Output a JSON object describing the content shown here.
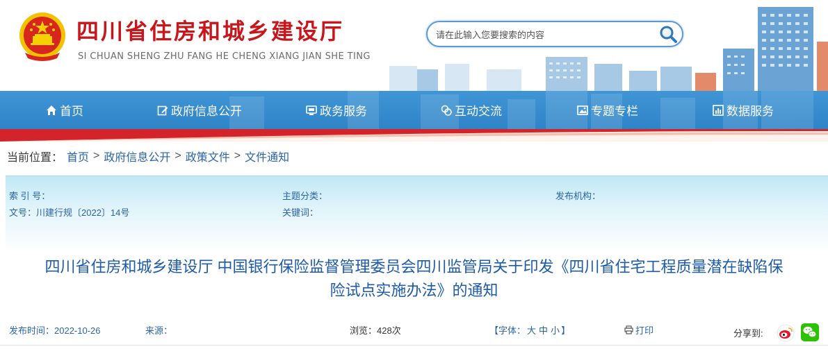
{
  "header": {
    "title": "四川省住房和城乡建设厅",
    "subtitle": "SI CHUAN SHENG ZHU FANG HE CHENG XIANG JIAN SHE TING",
    "emblem_icon": "national-emblem-icon"
  },
  "search": {
    "placeholder": "请在此输入您要搜索的内容",
    "icon": "search-icon"
  },
  "nav": {
    "items": [
      {
        "label": "首页",
        "icon": "home-icon"
      },
      {
        "label": "政府信息公开",
        "icon": "edit-icon"
      },
      {
        "label": "政务服务",
        "icon": "monitor-icon"
      },
      {
        "label": "互动交流",
        "icon": "chat-icon"
      },
      {
        "label": "专题专栏",
        "icon": "image-icon"
      },
      {
        "label": "数据服务",
        "icon": "chart-icon"
      }
    ]
  },
  "breadcrumb": {
    "prefix": "当前位置：",
    "items": [
      "首页",
      "政府信息公开",
      "政策文件",
      "文件通知"
    ],
    "separator": ">"
  },
  "meta": {
    "index_label": "索 引 号：",
    "index_value": "",
    "topic_label": "主题分类：",
    "topic_value": "",
    "publisher_label": "发布机构：",
    "publisher_value": "",
    "doc_no_label": "文号：",
    "doc_no_value": "川建行规〔2022〕14号",
    "keywords_label": "关键词：",
    "keywords_value": ""
  },
  "article": {
    "title_line1": "四川省住房和城乡建设厅 中国银行保险监督管理委员会四川监管局关于印发《四川省住宅工程质量潜在缺陷保",
    "title_line2": "险试点实施办法》的通知",
    "publish_time_label": "发布时间：",
    "publish_time": "2022-10-26",
    "source_label": "来源：",
    "source_value": "",
    "views_label": "浏览：",
    "views_value": "428次",
    "font_label": "【字体：",
    "font_large": "大",
    "font_medium": "中",
    "font_small": "小",
    "font_close": "】",
    "print_label": "打印",
    "share_label": "分享到:",
    "share_icons": [
      "weibo-icon",
      "wechat-icon"
    ]
  },
  "colors": {
    "nav_blue": "#3f95d5",
    "title_red": "#c8161d",
    "link_blue": "#2a64a8",
    "article_title_blue": "#1d5aa8"
  }
}
